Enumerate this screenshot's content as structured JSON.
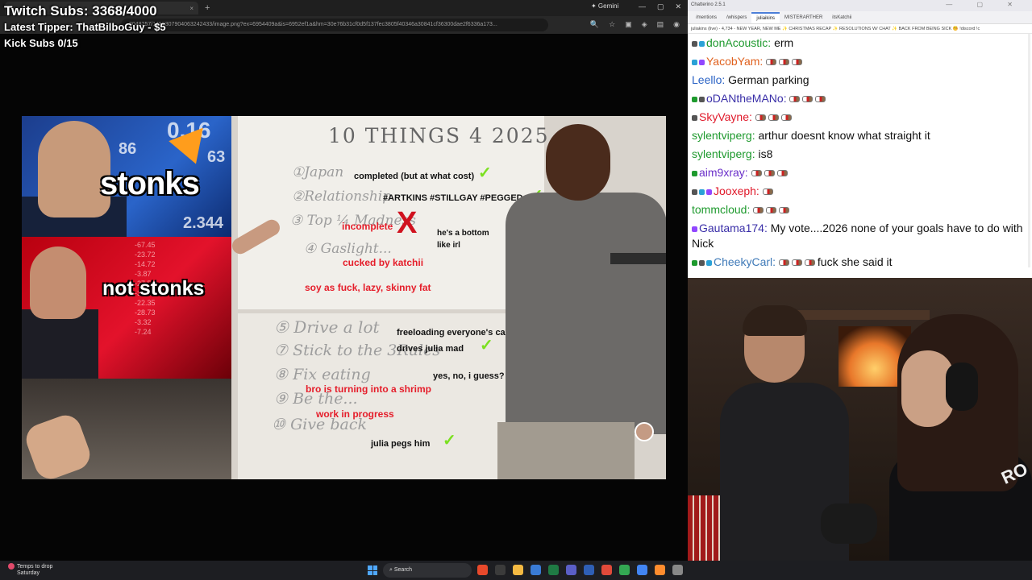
{
  "overlay": {
    "twitch_subs": "Twitch Subs: 3368/4000",
    "latest_tipper": "Latest Tipper: ThatBilboGuy - $5",
    "kick_subs": "Kick Subs 0/15"
  },
  "browser": {
    "tab_close": "×",
    "new_tab": "+",
    "gemini_label": "✦ Gemini",
    "url": "8048257/1455307904063242433/image.png?ex=6954409a&is=6952ef1a&hm=30e76b31cf0d5f137fec3805f40346a30841cf36300dae2f6336a173...",
    "window_controls": [
      "—",
      "▢",
      "✕"
    ]
  },
  "video": {
    "stonks": "stonks",
    "not_stonks": "not stonks",
    "tickers_blue": [
      "0.16",
      "86",
      "63",
      "2.344"
    ],
    "tickers_red": [
      "-67.45",
      "-23.72",
      "-14.72",
      "-3.87",
      "-27.55",
      "-37.24",
      "-22.35",
      "-28.73",
      "-3.32",
      "-7.24"
    ],
    "board_title": "10 THINGS 4 2025",
    "handwriting": [
      "①Japan",
      "②Relationship",
      "③ Top ¼ Madness",
      "④ Gaslight...",
      "⑤ Drive a lot",
      "⑦ Stick to the 3Rules",
      "⑧ Fix eating",
      "⑨ Be the...",
      "⑩ Give back"
    ],
    "annotations": {
      "a1": "completed (but at what cost)",
      "a2": "#ARTKINS #STILLGAY #PEGGED",
      "a3": "incomplete",
      "a4": "he's a bottom",
      "a4b": "like irl",
      "a5": "cucked by katchii",
      "a6": "soy as fuck, lazy, skinny fat",
      "a7": "freeloading everyone's cars,",
      "a7b": "drives julia mad",
      "a8": "yes, no, i guess?",
      "a9": "bro is turning into a shrimp",
      "a10": "work in progress",
      "a11": "julia pegs him"
    },
    "check_mark": "✓",
    "x_mark": "X"
  },
  "chatterino": {
    "title": "Chatterino 2.5.1",
    "window_controls": "— ▢ ✕",
    "tabs": [
      "/mentions",
      "/whispers",
      "juliaikins",
      "MISTERARTHER",
      "itsKatchii"
    ],
    "active_tab": 2,
    "status": "juliakins (live) - 4,734 - NEW YEAR, NEW ME ✨ CHRISTMAS RECAP ✨ RESOLUTIONS W/ CHAT ✨ BACK FROM BEING SICK 🤒 !discord !c",
    "messages": [
      {
        "user": "donAcoustic:",
        "text": "erm",
        "color": "#1e9a2e",
        "badges": 2,
        "emotes": 0
      },
      {
        "user": "YacobYam:",
        "text": "",
        "color": "#e0611e",
        "badges": 2,
        "emotes": 3
      },
      {
        "user": "Leello:",
        "text": "German parking",
        "color": "#2b63c5",
        "badges": 0,
        "emotes": 0
      },
      {
        "user": "oDANtheMANo:",
        "text": "",
        "color": "#3a2fa8",
        "badges": 2,
        "emotes": 3
      },
      {
        "user": "SkyVayne:",
        "text": "",
        "color": "#e0192a",
        "badges": 1,
        "emotes": 3
      },
      {
        "user": "sylentviperg:",
        "text": "arthur doesnt know what straight it",
        "color": "#1e9a2e",
        "badges": 0,
        "emotes": 0
      },
      {
        "user": "sylentviperg:",
        "text": "is8",
        "color": "#1e9a2e",
        "badges": 0,
        "emotes": 0
      },
      {
        "user": "aim9xray:",
        "text": "",
        "color": "#6a2fc9",
        "badges": 1,
        "emotes": 3
      },
      {
        "user": "Jooxeph:",
        "text": "",
        "color": "#e0192a",
        "badges": 3,
        "emotes": 1
      },
      {
        "user": "tommcloud:",
        "text": "",
        "color": "#1e9a2e",
        "badges": 0,
        "emotes": 3
      },
      {
        "user": "Gautama174:",
        "text": "My vote....2026 none of your goals have to do with Nick",
        "color": "#3a2fa8",
        "badges": 1,
        "emotes": 0
      },
      {
        "user": "CheekyCarl:",
        "text": "fuck she said it",
        "color": "#3f7ab8",
        "badges": 3,
        "emotes": 3
      }
    ]
  },
  "webcam": {
    "logo": "RO"
  },
  "taskbar": {
    "weather_title": "Temps to drop",
    "weather_sub": "Saturday",
    "search": "Search",
    "icon_colors": [
      "#e8492b",
      "#3b3b3b",
      "#f4b942",
      "#3a7bd5",
      "#1f7a44",
      "#5b5fc7",
      "#2f5fb5",
      "#e14a3a",
      "#34a853",
      "#4285f4",
      "#ff8c2e",
      "#888"
    ]
  },
  "colors": {
    "chat_bg": "#ffffff",
    "annotation_red": "#e51d2a",
    "check_green": "#7be020"
  }
}
